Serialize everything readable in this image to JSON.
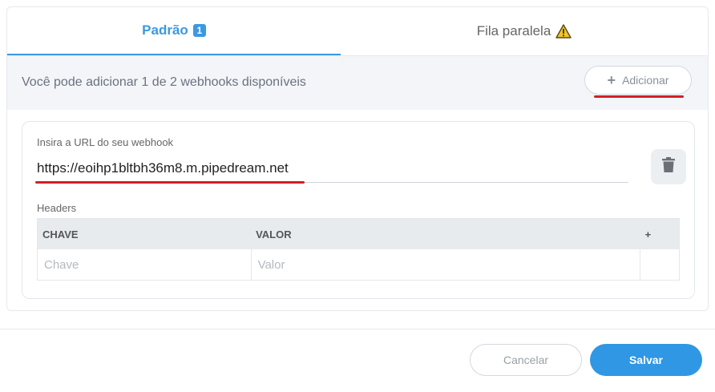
{
  "tabs": [
    {
      "label": "Padrão",
      "badge": "1",
      "active": true
    },
    {
      "label": "Fila paralela",
      "icon": "warning-icon",
      "active": false
    }
  ],
  "info": {
    "text": "Você pode adicionar 1 de 2 webhooks disponíveis",
    "add_icon": "plus-icon",
    "add_label": "Adicionar"
  },
  "webhook": {
    "url_label": "Insira a URL do seu webhook",
    "url_value": "https://eoihp1bltbh36m8.m.pipedream.net",
    "delete_icon": "trash-icon",
    "headers_label": "Headers",
    "columns": [
      "CHAVE",
      "VALOR"
    ],
    "add_header_icon": "plus-icon",
    "key_placeholder": "Chave",
    "value_placeholder": "Valor"
  },
  "footer": {
    "cancel_label": "Cancelar",
    "save_label": "Salvar"
  },
  "colors": {
    "accent": "#3b99e0",
    "save_button": "#2f97e3",
    "annotation_red": "#d21f26",
    "warning": "#f2c233"
  }
}
